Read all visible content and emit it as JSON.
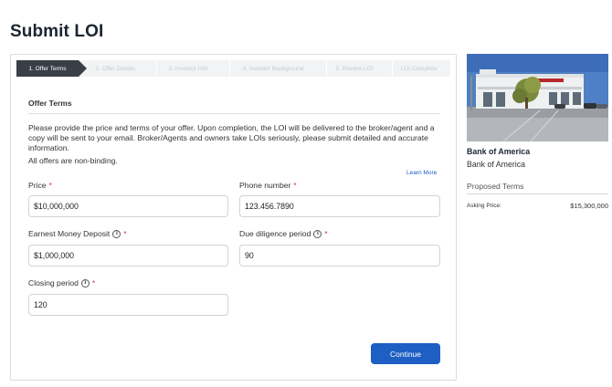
{
  "page": {
    "title": "Submit LOI"
  },
  "steps": [
    {
      "label": "1. Offer Terms",
      "active": true
    },
    {
      "label": "2. Offer Details",
      "active": false
    },
    {
      "label": "3. Investor Info",
      "active": false
    },
    {
      "label": "4. Investor Background",
      "active": false
    },
    {
      "label": "5. Review LOI",
      "active": false
    },
    {
      "label": "LOI Complete",
      "active": false
    }
  ],
  "offer": {
    "section_title": "Offer Terms",
    "intro": "Please provide the price and terms of your offer. Upon completion, the LOI will be delivered to the broker/agent and a copy will be sent to your email. Broker/Agents and owners take LOIs seriously, please submit detailed and accurate information.",
    "nonbinding": "All offers are non-binding.",
    "learn_more": "Learn More",
    "required_mark": "*",
    "info_glyph": "i",
    "fields": {
      "price": {
        "label": "Price",
        "value": "$10,000,000"
      },
      "phone": {
        "label": "Phone number",
        "value": "123.456.7890"
      },
      "earnest": {
        "label": "Earnest Money Deposit",
        "value": "$1,000,000"
      },
      "due": {
        "label": "Due diligence period",
        "value": "90"
      },
      "closing": {
        "label": "Closing period",
        "value": "120"
      }
    },
    "continue_label": "Continue"
  },
  "property": {
    "name": "Bank of America",
    "subtitle": "Bank of America",
    "proposed_title": "Proposed Terms",
    "asking_label": "Asking Price:",
    "asking_value": "$15,300,000"
  },
  "colors": {
    "accent": "#1d5fc2",
    "link": "#1a5fc4",
    "active_step": "#3a3f47",
    "required": "#d12b2b"
  },
  "icons": [
    "info-icon"
  ]
}
